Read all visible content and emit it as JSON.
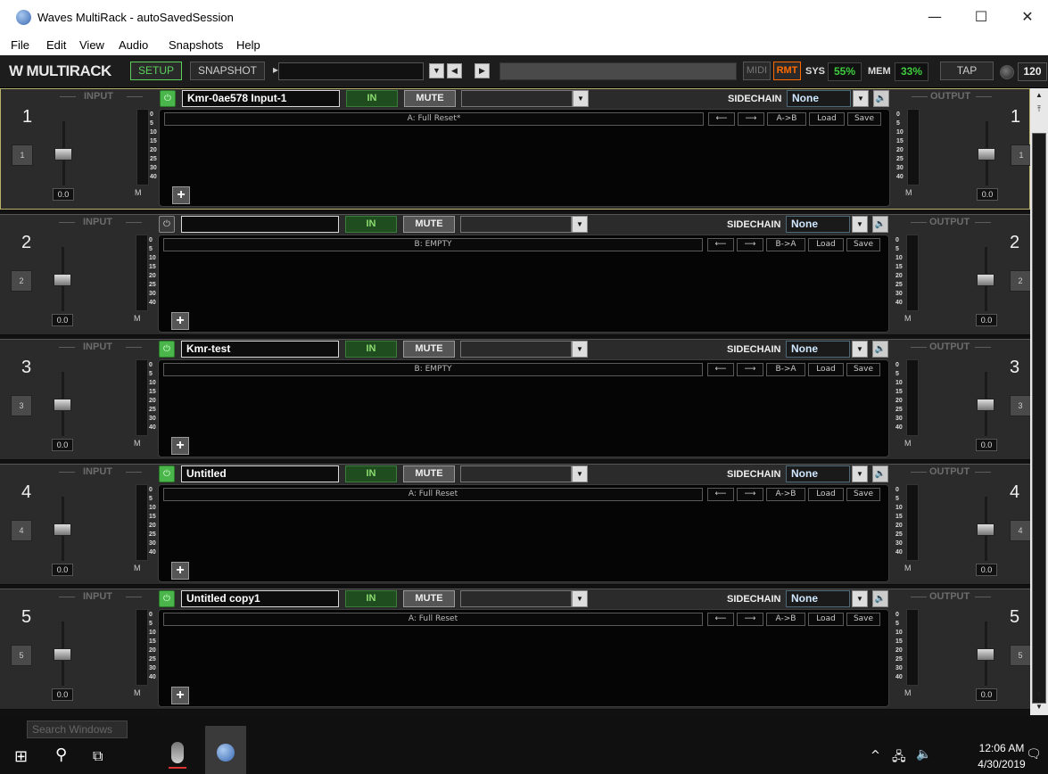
{
  "window": {
    "title": "Waves MultiRack - autoSavedSession",
    "minimize": "—",
    "maximize": "☐",
    "close": "✕"
  },
  "menu": [
    "File",
    "Edit",
    "View",
    "Audio",
    "Snapshots",
    "Help"
  ],
  "toolbar": {
    "logo": "MULTIRACK",
    "logo_mark": "W",
    "setup": "SETUP",
    "snapshot": "SNAPSHOT",
    "snapshot_arrow": "▸",
    "combo_arrow": "▼",
    "prev": "◀",
    "next": "▶",
    "midi": "MIDI",
    "rmt": "RMT",
    "sys_label": "SYS",
    "sys_value": "55%",
    "mem_label": "MEM",
    "mem_value": "33%",
    "tap": "TAP",
    "tempo": "120"
  },
  "rack_common": {
    "input": "INPUT",
    "output": "OUTPUT",
    "sidechain": "SIDECHAIN",
    "sidechain_value": "None",
    "in": "IN",
    "mute": "MUTE",
    "power": "⏻",
    "dropdown": "▼",
    "speaker": "🔈",
    "gain_in": "0.0",
    "gain_out": "0.0",
    "m": "M",
    "meter_scale": [
      "0",
      "5",
      "10",
      "15",
      "20",
      "25",
      "30",
      "40"
    ],
    "prev": "⟵",
    "next": "⟶",
    "load": "Load",
    "save": "Save",
    "add": "+"
  },
  "racks": [
    {
      "num": "1",
      "name": "Kmr-0ae578 Input-1",
      "power_on": true,
      "preset": "A: Full Reset*",
      "ab": "A->B"
    },
    {
      "num": "2",
      "name": "",
      "power_on": false,
      "preset": "B: EMPTY",
      "ab": "B->A"
    },
    {
      "num": "3",
      "name": "Kmr-test",
      "power_on": true,
      "preset": "B: EMPTY",
      "ab": "B->A"
    },
    {
      "num": "4",
      "name": "Untitled",
      "power_on": true,
      "preset": "A: Full Reset",
      "ab": "A->B"
    },
    {
      "num": "5",
      "name": "Untitled copy1",
      "power_on": true,
      "preset": "A: Full Reset",
      "ab": "A->B"
    }
  ],
  "scrollbar": {
    "up": "▲",
    "top": "⤒",
    "bottom": "⤓",
    "down": "▼"
  },
  "taskbar": {
    "search_windows": "Search Windows",
    "start": "⊞",
    "search": "⚲",
    "taskview": "⧉",
    "tray_chevron": "^",
    "tray_network": "🖧",
    "tray_volume": "🔈",
    "time": "12:06 AM",
    "date": "4/30/2019",
    "notifications": "🗨"
  }
}
